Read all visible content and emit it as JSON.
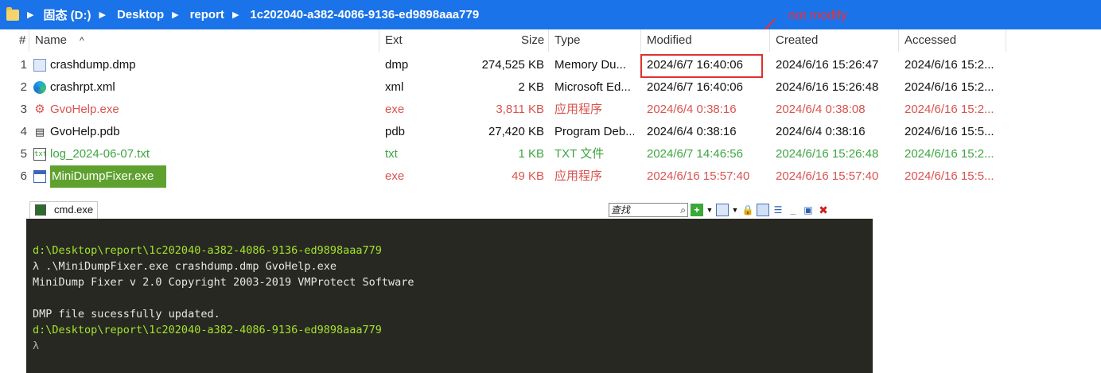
{
  "breadcrumb": {
    "items": [
      "固态 (D:)",
      "Desktop",
      "report",
      "1c202040-a382-4086-9136-ed9898aaa779"
    ]
  },
  "annotation": {
    "text": "not modify",
    "color": "#ff2a2a"
  },
  "columns": {
    "num": "#",
    "name": "Name",
    "ext": "Ext",
    "size": "Size",
    "type": "Type",
    "modified": "Modified",
    "created": "Created",
    "accessed": "Accessed"
  },
  "files": [
    {
      "num": "1",
      "icon": "dump-file-icon",
      "name": "crashdump.dmp",
      "ext": "dmp",
      "size": "274,525 KB",
      "type": "Memory Du...",
      "modified": "2024/6/7 16:40:06",
      "created": "2024/6/16 15:26:47",
      "accessed": "2024/6/16 15:2..."
    },
    {
      "num": "2",
      "icon": "edge-icon",
      "name": "crashrpt.xml",
      "ext": "xml",
      "size": "2 KB",
      "type": "Microsoft Ed...",
      "modified": "2024/6/7 16:40:06",
      "created": "2024/6/16 15:26:48",
      "accessed": "2024/6/16 15:2..."
    },
    {
      "num": "3",
      "icon": "exe-gear-icon",
      "name": "GvoHelp.exe",
      "ext": "exe",
      "size": "3,811 KB",
      "type": "应用程序",
      "modified": "2024/6/4 0:38:16",
      "created": "2024/6/4 0:38:08",
      "accessed": "2024/6/16 15:2..."
    },
    {
      "num": "4",
      "icon": "pdb-file-icon",
      "name": "GvoHelp.pdb",
      "ext": "pdb",
      "size": "27,420 KB",
      "type": "Program Deb...",
      "modified": "2024/6/4 0:38:16",
      "created": "2024/6/4 0:38:16",
      "accessed": "2024/6/16 15:5..."
    },
    {
      "num": "5",
      "icon": "txt-file-icon",
      "name": "log_2024-06-07.txt",
      "ext": "txt",
      "size": "1 KB",
      "type": "TXT 文件",
      "modified": "2024/6/7 14:46:56",
      "created": "2024/6/16 15:26:48",
      "accessed": "2024/6/16 15:2..."
    },
    {
      "num": "6",
      "icon": "window-exe-icon",
      "name": "MiniDumpFixer.exe",
      "ext": "exe",
      "size": "49 KB",
      "type": "应用程序",
      "modified": "2024/6/16 15:57:40",
      "created": "2024/6/16 15:57:40",
      "accessed": "2024/6/16 15:5..."
    }
  ],
  "terminal": {
    "tab_label": "cmd.exe",
    "search_placeholder": "查找",
    "lines": [
      {
        "text": "d:\\Desktop\\report\\1c202040-a382-4086-9136-ed9898aaa779"
      },
      {
        "text": "λ .\\MiniDumpFixer.exe crashdump.dmp GvoHelp.exe"
      },
      {
        "text": "MiniDump Fixer v 2.0 Copyright 2003-2019 VMProtect Software"
      },
      {
        "text": ""
      },
      {
        "text": "DMP file sucessfully updated."
      },
      {
        "text": "d:\\Desktop\\report\\1c202040-a382-4086-9136-ed9898aaa779"
      },
      {
        "text": "λ"
      }
    ]
  },
  "colors": {
    "breadcrumb_bg": "#1a73e8",
    "exe_text": "#d9534f",
    "txt_text": "#3ea641",
    "selection_bg": "#5fa12e",
    "console_bg": "#272822",
    "console_path": "#a6e22e"
  }
}
